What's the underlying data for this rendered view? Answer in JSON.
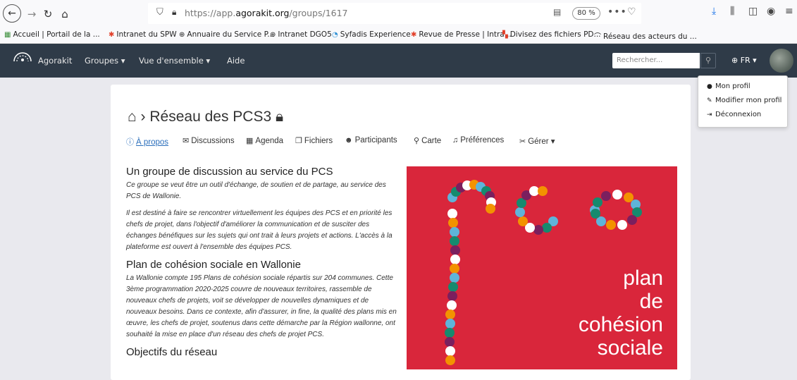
{
  "browser": {
    "url_prefix": "https://app.",
    "url_domain": "agorakit.org",
    "url_path": "/groups/1617",
    "zoom": "80 %",
    "bookmarks": [
      "Accueil | Portail de la ...",
      "Intranet du SPW",
      "Annuaire du Service P...",
      "Intranet DGO5",
      "Syfadis Experience",
      "Revue de Presse | Intra...",
      "Divisez des fichiers PD...",
      "Réseau des acteurs du ..."
    ]
  },
  "nav": {
    "brand": "Agorakit",
    "groups": "Groupes ▾",
    "overview": "Vue d'ensemble ▾",
    "help": "Aide",
    "search_placeholder": "Rechercher...",
    "lang": "FR ▾"
  },
  "user_menu": {
    "items": [
      "Mon profil",
      "Modifier mon profil",
      "Déconnexion"
    ]
  },
  "group": {
    "title": "Réseau des PCS3",
    "tabs": [
      "À propos",
      "Discussions",
      "Agenda",
      "Fichiers",
      "Participants",
      "Carte",
      "Préférences",
      "Gérer ▾"
    ]
  },
  "content": {
    "h1": "Un groupe de discussion au service du PCS",
    "p1": "Ce groupe se veut être un outil d'échange, de soutien et de partage, au service des PCS de Wallonie.",
    "p2": "Il est destiné à faire se rencontrer virtuellement les équipes des PCS et en priorité les chefs de projet, dans l'objectif d'améliorer la communication et de susciter des échanges bénéfiques sur les sujets qui ont trait à leurs projets et actions. L'accès à la plateforme est ouvert à l'ensemble des équipes PCS.",
    "h2": "Plan de cohésion sociale en Wallonie",
    "p3": "La Wallonie compte 195 Plans de cohésion sociale répartis sur 204 communes. Cette 3ème programmation 2020-2025 couvre de nouveaux territoires, rassemble de nouveaux chefs de projets, voit se développer de nouvelles dynamiques et de nouveaux besoins. Dans ce contexte, afin d'assurer, in fine, la qualité des plans mis en œuvre, les chefs de projet, soutenus dans cette démarche par la Région wallonne, ont souhaité la mise en place d'un réseau des chefs de projet PCS.",
    "h3": "Objectifs du réseau"
  },
  "logo": {
    "line1": "plan",
    "line2": "de",
    "line3": "cohésion",
    "line4": "sociale",
    "colors": [
      "#ffffff",
      "#f39200",
      "#5fb4d9",
      "#168a6e",
      "#7b1f5e"
    ]
  }
}
